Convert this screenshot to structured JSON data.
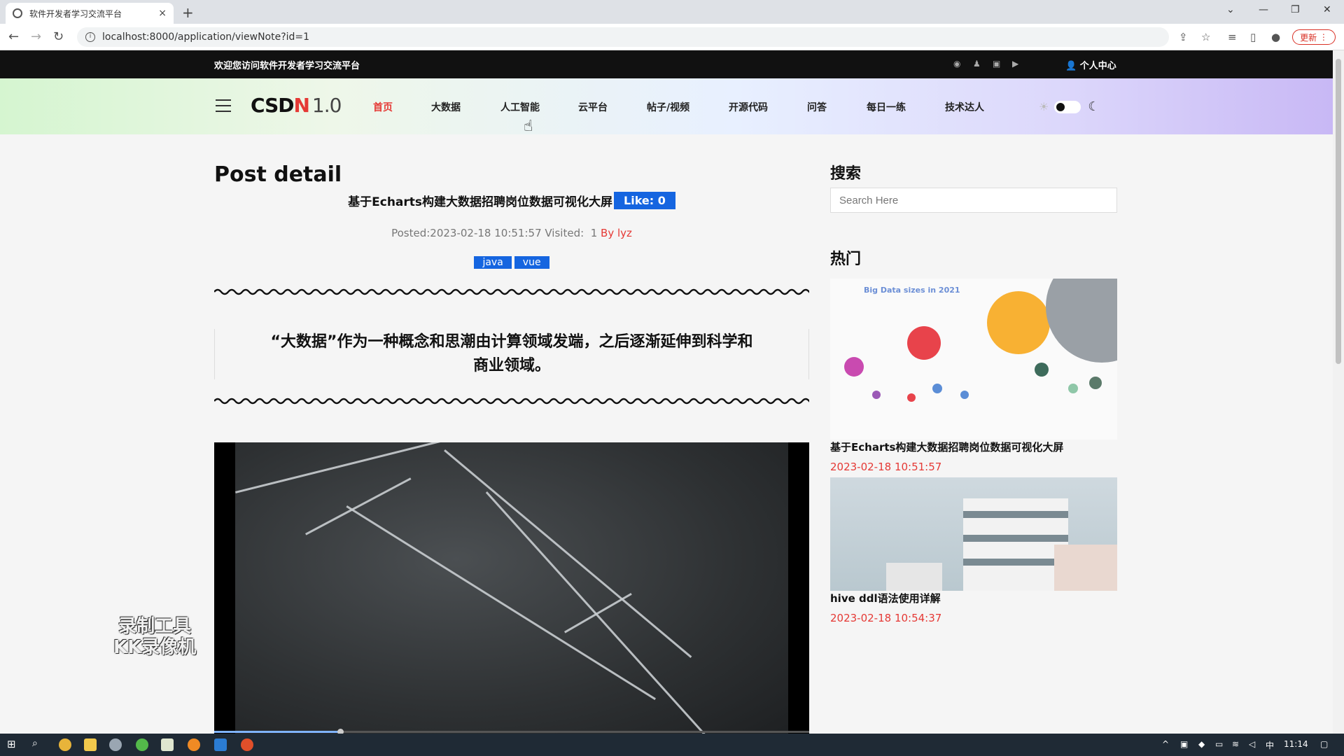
{
  "browser": {
    "tab_title": "软件开发者学习交流平台",
    "tab_close": "×",
    "new_tab": "+",
    "url": "localhost:8000/application/viewNote?id=1",
    "update_label": "更新"
  },
  "site_top": {
    "welcome": "欢迎您访问软件开发者学习交流平台",
    "user_center": "个人中心"
  },
  "nav": {
    "logo_main": "CSD",
    "logo_accent": "N",
    "logo_version": "1.0",
    "items": [
      "首页",
      "大数据",
      "人工智能",
      "云平台",
      "帖子/视频",
      "开源代码",
      "问答",
      "每日一练",
      "技术达人"
    ],
    "active_index": 0
  },
  "post": {
    "heading": "Post detail",
    "title": "基于Echarts构建大数据招聘岗位数据可视化大屏",
    "like_label": "Like: 0",
    "meta_posted": "Posted:2023-02-18 10:51:57 Visited:",
    "meta_visited": "1",
    "meta_author": "By lyz",
    "tags": [
      "java",
      "vue"
    ],
    "quote": "“大数据”作为一种概念和思潮由计算领域发端，之后逐渐延伸到科学和商业领域。"
  },
  "watermark": {
    "line1": "录制工具",
    "line2": "KK录像机"
  },
  "sidebar": {
    "search_heading": "搜索",
    "search_placeholder": "Search Here",
    "hot_heading": "热门",
    "hot_items": [
      {
        "title": "基于Echarts构建大数据招聘岗位数据可视化大屏",
        "date": "2023-02-18 10:51:57",
        "image_caption": "Big Data sizes in 2021"
      },
      {
        "title": "hive ddl语法使用详解",
        "date": "2023-02-18 10:54:37"
      }
    ]
  },
  "taskbar": {
    "time": "11:14",
    "ime": "中"
  },
  "colors": {
    "accent_red": "#e53935",
    "accent_blue": "#1565e0",
    "top_strip": "#111111"
  }
}
